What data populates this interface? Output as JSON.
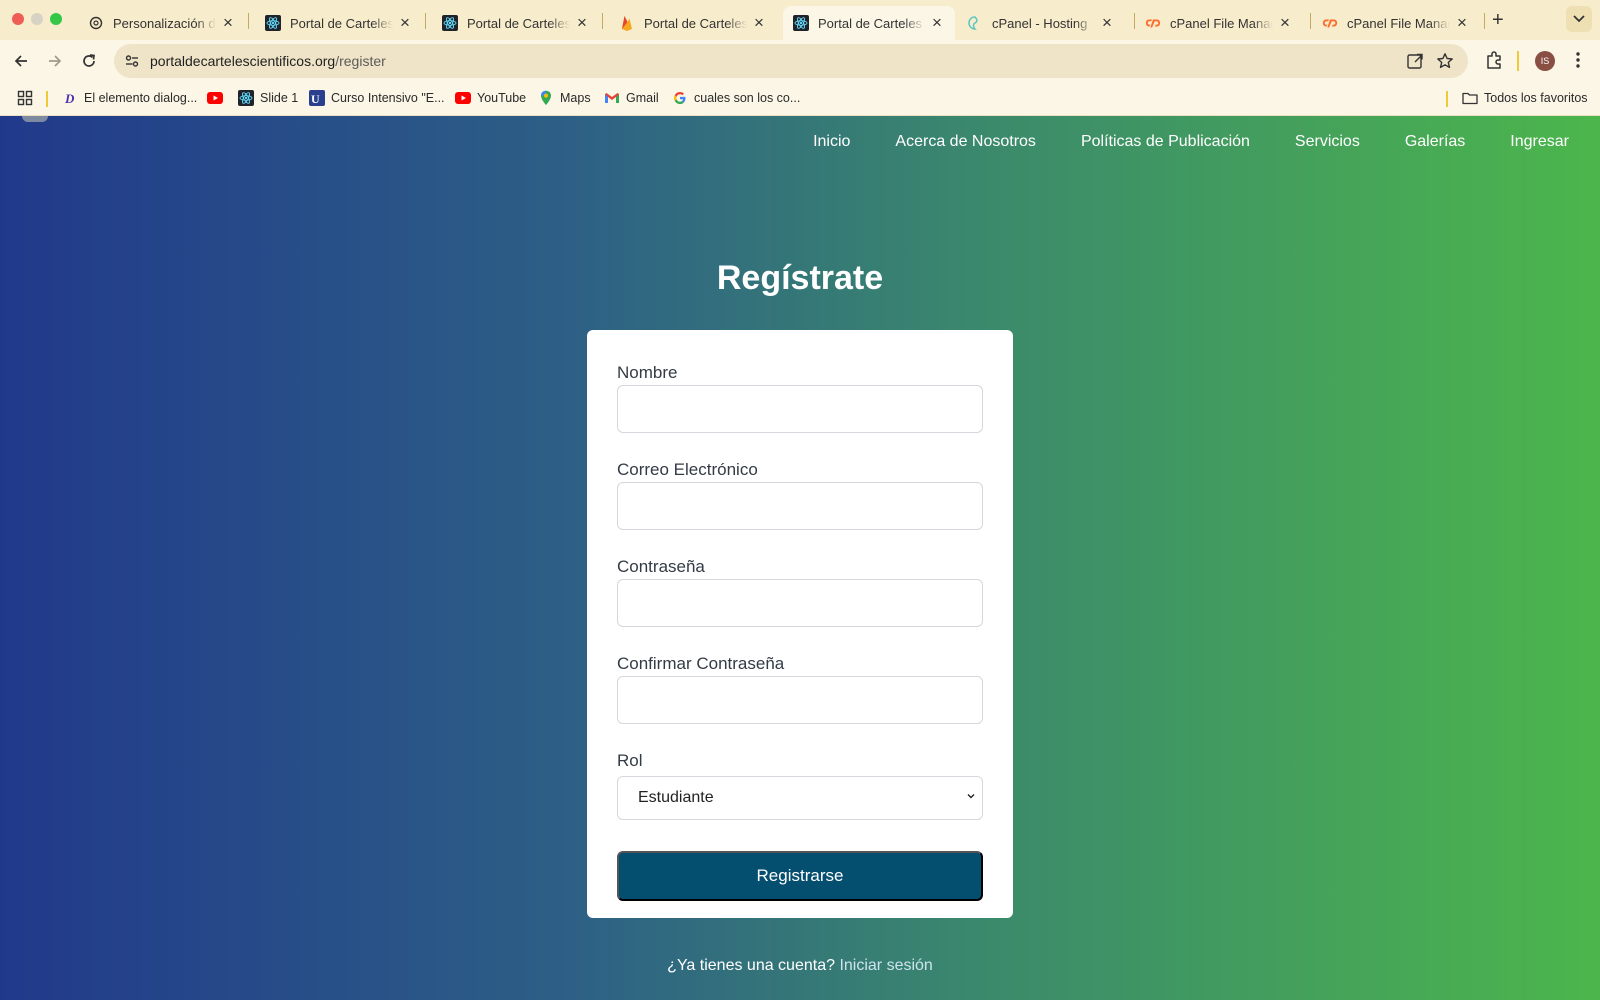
{
  "browser": {
    "tabs": [
      {
        "title": "Personalización de l",
        "favicon": "openai-icon",
        "active": false
      },
      {
        "title": "Portal de Carteles C",
        "favicon": "react-icon",
        "active": false
      },
      {
        "title": "Portal de Carteles C",
        "favicon": "react-icon",
        "active": false
      },
      {
        "title": "Portal de Carteles C",
        "favicon": "firebase-icon",
        "active": false
      },
      {
        "title": "Portal de Carteles C",
        "favicon": "react-icon",
        "active": true
      },
      {
        "title": "cPanel - Hosting",
        "favicon": "hosting-icon",
        "active": false
      },
      {
        "title": "cPanel File Manager",
        "favicon": "cpanel-icon",
        "active": false
      },
      {
        "title": "cPanel File Manager",
        "favicon": "cpanel-icon",
        "active": false
      }
    ],
    "url": {
      "domain": "portaldecartelescientificos.org",
      "path": "/register"
    },
    "profile_initials": "IS",
    "bookmarks": [
      {
        "label": "El elemento dialog...",
        "icon": "d-icon"
      },
      {
        "label": "",
        "icon": "youtube-icon"
      },
      {
        "label": "Slide 1",
        "icon": "react-icon"
      },
      {
        "label": "Curso Intensivo \"E...",
        "icon": "book-icon"
      },
      {
        "label": "YouTube",
        "icon": "youtube-icon"
      },
      {
        "label": "Maps",
        "icon": "maps-icon"
      },
      {
        "label": "Gmail",
        "icon": "gmail-icon"
      },
      {
        "label": "cuales son los co...",
        "icon": "google-icon"
      }
    ],
    "all_bookmarks_label": "Todos los favoritos"
  },
  "site": {
    "nav": [
      "Inicio",
      "Acerca de Nosotros",
      "Políticas de Publicación",
      "Servicios",
      "Galerías",
      "Ingresar"
    ],
    "title": "Regístrate",
    "form": {
      "name_label": "Nombre",
      "name_value": "",
      "email_label": "Correo Electrónico",
      "email_value": "",
      "password_label": "Contraseña",
      "password_value": "",
      "confirm_label": "Confirmar Contraseña",
      "confirm_value": "",
      "role_label": "Rol",
      "role_value": "Estudiante",
      "submit_label": "Registrarse"
    },
    "login_prompt": "¿Ya tienes una cuenta?",
    "login_link": "Iniciar sesión"
  },
  "colors": {
    "gradient_start": "#21398b",
    "gradient_end": "#4cb64b",
    "primary_button": "#044e70",
    "tab_strip": "#f7eccb"
  }
}
